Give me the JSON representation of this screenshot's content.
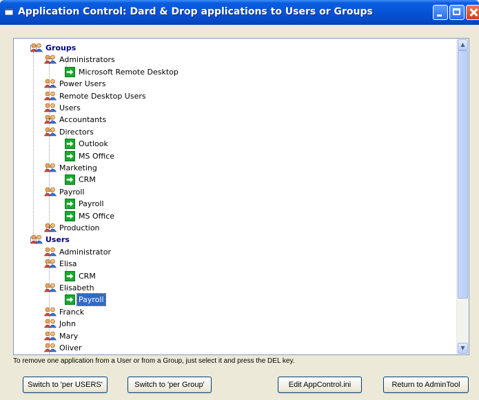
{
  "window": {
    "title": "Application Control: Dard & Drop applications to Users or Groups"
  },
  "tree": {
    "rows": [
      {
        "label": "Groups",
        "kind": "group",
        "bold": true,
        "level": 0,
        "expander": "minus"
      },
      {
        "label": "Administrators",
        "kind": "group",
        "level": 1,
        "expander": "minus"
      },
      {
        "label": "Microsoft Remote Desktop",
        "kind": "app",
        "level": 2
      },
      {
        "label": "Power Users",
        "kind": "group",
        "level": 1
      },
      {
        "label": "Remote Desktop Users",
        "kind": "group",
        "level": 1
      },
      {
        "label": "Users",
        "kind": "group",
        "level": 1
      },
      {
        "label": "Accountants",
        "kind": "group",
        "level": 1,
        "expander": "plus"
      },
      {
        "label": "Directors",
        "kind": "group",
        "level": 1,
        "expander": "minus"
      },
      {
        "label": "Outlook",
        "kind": "app",
        "level": 2
      },
      {
        "label": "MS Office",
        "kind": "app",
        "level": 2
      },
      {
        "label": "Marketing",
        "kind": "group",
        "level": 1,
        "expander": "minus"
      },
      {
        "label": "CRM",
        "kind": "app",
        "level": 2
      },
      {
        "label": "Payroll",
        "kind": "group",
        "level": 1,
        "expander": "minus"
      },
      {
        "label": "Payroll",
        "kind": "app",
        "level": 2
      },
      {
        "label": "MS Office",
        "kind": "app",
        "level": 2
      },
      {
        "label": "Production",
        "kind": "group",
        "level": 1,
        "expander": "plus"
      },
      {
        "label": "Users",
        "kind": "group",
        "bold": true,
        "level": 0,
        "expander": "minus"
      },
      {
        "label": "Administrator",
        "kind": "group",
        "level": 1
      },
      {
        "label": "Elisa",
        "kind": "group",
        "level": 1,
        "expander": "minus"
      },
      {
        "label": "CRM",
        "kind": "app",
        "level": 2
      },
      {
        "label": "Elisabeth",
        "kind": "group",
        "level": 1,
        "expander": "minus"
      },
      {
        "label": "Payroll",
        "kind": "app",
        "level": 2,
        "selected": true
      },
      {
        "label": "Franck",
        "kind": "group",
        "level": 1
      },
      {
        "label": "John",
        "kind": "group",
        "level": 1
      },
      {
        "label": "Mary",
        "kind": "group",
        "level": 1
      },
      {
        "label": "Oliver",
        "kind": "group",
        "level": 1
      }
    ]
  },
  "hint": "To remove one application from a User or from a Group, just select it and press the DEL key.",
  "buttons": {
    "per_users": "Switch to 'per USERS'",
    "per_group": "Switch to 'per Group'",
    "edit_ini": "Edit AppControl.ini",
    "return_admin": "Return to AdminTool"
  },
  "icons": {
    "group": "users-group-icon",
    "app": "green-arrow-icon"
  },
  "colors": {
    "title_bar": "#0753d6",
    "group_header_text": "#00008b",
    "app_icon": "#1aa82e",
    "selection": "#316ac5"
  }
}
